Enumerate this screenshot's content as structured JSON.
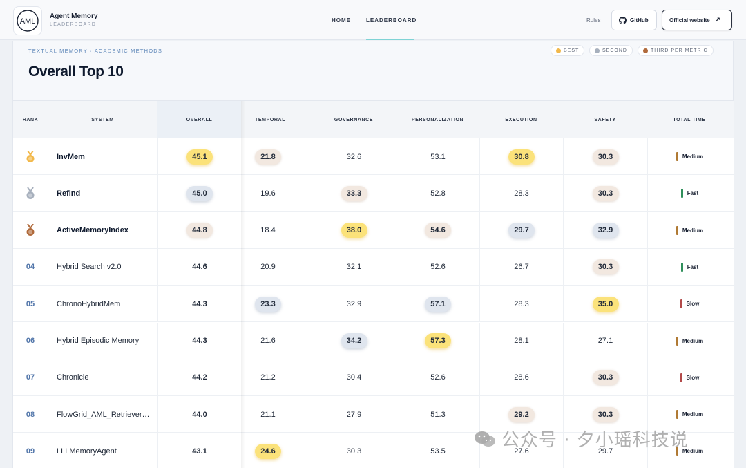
{
  "brand": {
    "logo_text": "AML",
    "title": "Agent Memory",
    "subtitle": "LEADERBOARD"
  },
  "nav": {
    "home": "HOME",
    "leaderboard": "LEADERBOARD",
    "rules": "Rules",
    "github": "GitHub",
    "official": "Official website",
    "official_icon": "external-link-icon"
  },
  "section": {
    "breadcrumb": "TEXTUAL MEMORY · ACADEMIC METHODS",
    "title": "Overall Top 10"
  },
  "legend": {
    "best": "BEST",
    "second": "SECOND",
    "third": "THIRD PER METRIC"
  },
  "colors": {
    "gold": "#f2b84a",
    "silver": "#a7b0bd",
    "bronze": "#b06a3b",
    "fast": "#2f8f5b",
    "medium": "#b07a34",
    "slow": "#b34a4a"
  },
  "table": {
    "headers": {
      "rank": "RANK",
      "system": "SYSTEM",
      "overall": "OVERALL",
      "temporal": "TEMPORAL",
      "governance": "GOVERNANCE",
      "personalization": "PERSONALIZATION",
      "execution": "EXECUTION",
      "safety": "SAFETY",
      "time": "TOTAL TIME"
    },
    "rows": [
      {
        "rank": "",
        "medal": "gold",
        "system": "InvMem",
        "overall": "45.1",
        "temporal": "21.8",
        "governance": "32.6",
        "personalization": "53.1",
        "execution": "30.8",
        "safety": "30.3",
        "time": "Medium"
      },
      {
        "rank": "",
        "medal": "silver",
        "system": "Refind",
        "overall": "45.0",
        "temporal": "19.6",
        "governance": "33.3",
        "personalization": "52.8",
        "execution": "28.3",
        "safety": "30.3",
        "time": "Fast"
      },
      {
        "rank": "",
        "medal": "bronze",
        "system": "ActiveMemoryIndex",
        "overall": "44.8",
        "temporal": "18.4",
        "governance": "38.0",
        "personalization": "54.6",
        "execution": "29.7",
        "safety": "32.9",
        "time": "Medium"
      },
      {
        "rank": "04",
        "system": "Hybrid Search v2.0",
        "overall": "44.6",
        "temporal": "20.9",
        "governance": "32.1",
        "personalization": "52.6",
        "execution": "26.7",
        "safety": "30.3",
        "time": "Fast"
      },
      {
        "rank": "05",
        "system": "ChronoHybridMem",
        "overall": "44.3",
        "temporal": "23.3",
        "governance": "32.9",
        "personalization": "57.1",
        "execution": "28.3",
        "safety": "35.0",
        "time": "Slow"
      },
      {
        "rank": "06",
        "system": "Hybrid Episodic Memory",
        "overall": "44.3",
        "temporal": "21.6",
        "governance": "34.2",
        "personalization": "57.3",
        "execution": "28.1",
        "safety": "27.1",
        "time": "Medium"
      },
      {
        "rank": "07",
        "system": "Chronicle",
        "overall": "44.2",
        "temporal": "21.2",
        "governance": "30.4",
        "personalization": "52.6",
        "execution": "28.6",
        "safety": "30.3",
        "time": "Slow"
      },
      {
        "rank": "08",
        "system": "FlowGrid_AML_Retriever…",
        "overall": "44.0",
        "temporal": "21.1",
        "governance": "27.9",
        "personalization": "51.3",
        "execution": "29.2",
        "safety": "30.3",
        "time": "Medium"
      },
      {
        "rank": "09",
        "system": "LLLMemoryAgent",
        "overall": "43.1",
        "temporal": "24.6",
        "governance": "30.3",
        "personalization": "53.5",
        "execution": "27.6",
        "safety": "29.7",
        "time": "Medium"
      }
    ]
  },
  "watermark": "公众号 · 夕小瑶科技说"
}
